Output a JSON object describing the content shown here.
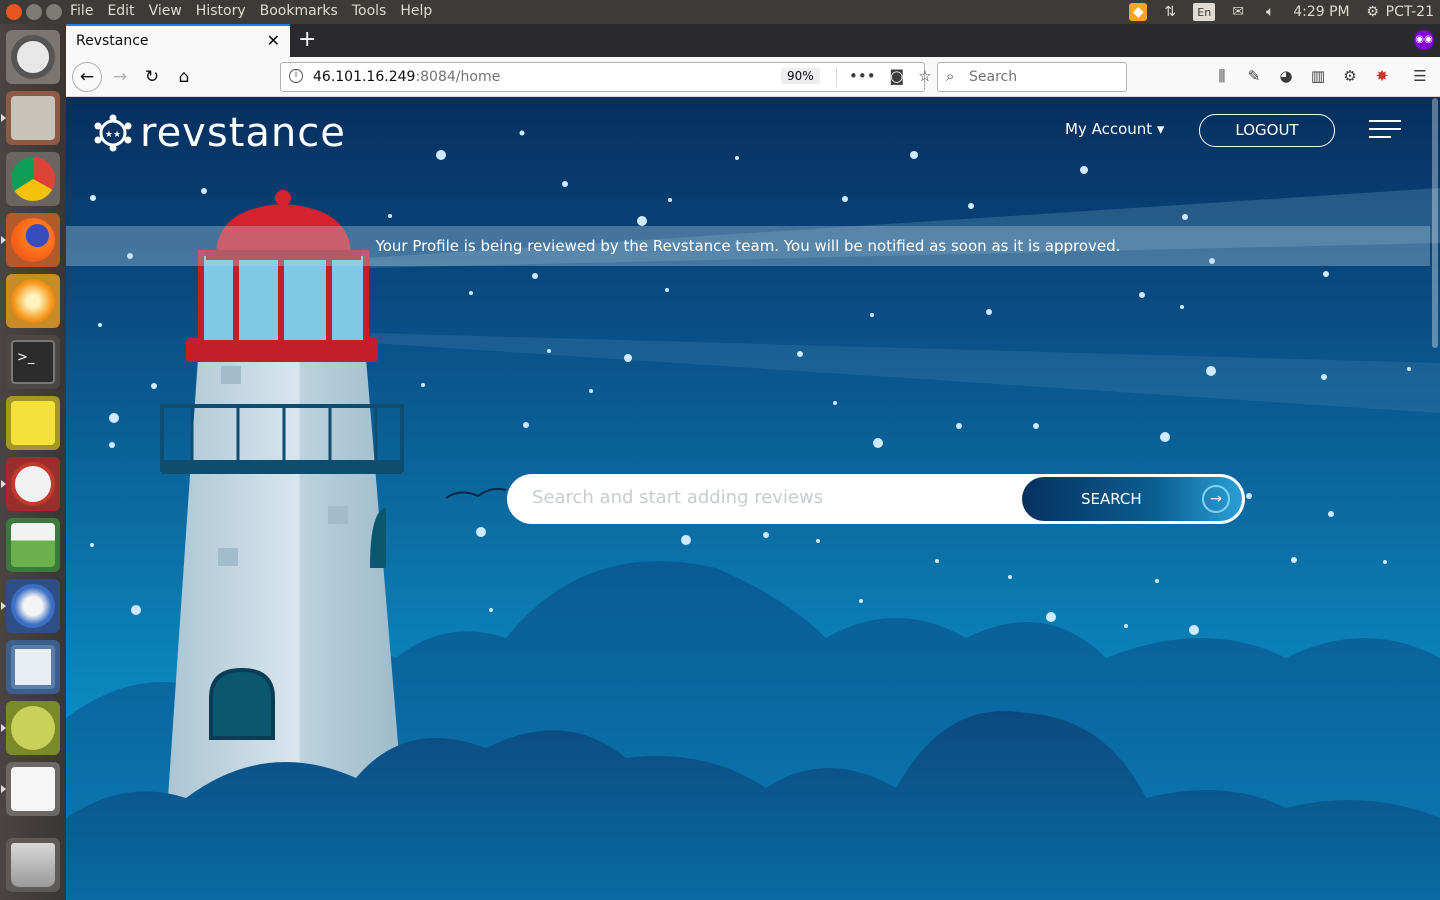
{
  "topbar": {
    "menus": [
      "File",
      "Edit",
      "View",
      "History",
      "Bookmarks",
      "Tools",
      "Help"
    ],
    "keyboard": "En",
    "time": "4:29 PM",
    "user": "PCT-21"
  },
  "launcher": {
    "apps": [
      "ubuntu-dash",
      "files",
      "chrome",
      "firefox",
      "burning-tool",
      "terminal",
      "sticky-notes",
      "document-viewer",
      "spreadsheet",
      "thunderbird",
      "image-viewer",
      "disk-usage",
      "text-editor",
      "trash"
    ]
  },
  "browser": {
    "tab_title": "Revstance",
    "url_host": "46.101.16.249",
    "url_rest": ":8084/home",
    "zoom": "90%",
    "search_placeholder": "Search"
  },
  "site": {
    "logo_text": "revstance",
    "account_label": "My Account ▾",
    "logout_label": "LOGOUT",
    "notice": "Your Profile is being reviewed by the Revstance team. You will be notified as soon as it is approved.",
    "search_placeholder": "Search and start adding reviews",
    "search_button": "SEARCH"
  },
  "colors": {
    "sky_top": "#062f5e",
    "sky_bottom": "#0aa3d3",
    "lighthouse_red": "#d4222f",
    "accent": "#0a84ff"
  }
}
